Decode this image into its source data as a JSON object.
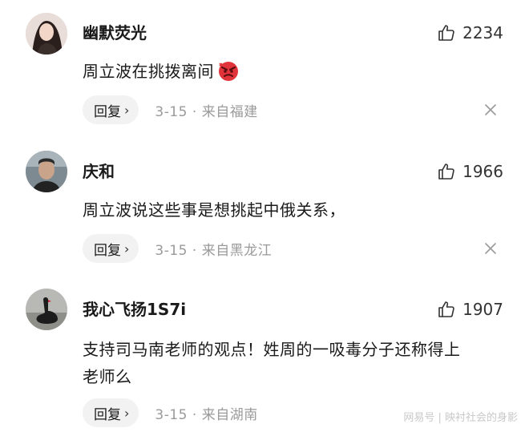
{
  "comments": [
    {
      "username": "幽默荧光",
      "likes": "2234",
      "text": "周立波在挑拨离间",
      "emoji": "angry-face",
      "reply_label": "回复",
      "meta": "3-15 · 来自福建"
    },
    {
      "username": "庆和",
      "likes": "1966",
      "text": "周立波说这些事是想挑起中俄关系，",
      "reply_label": "回复",
      "meta": "3-15 · 来自黑龙江"
    },
    {
      "username": "我心飞扬1S7i",
      "likes": "1907",
      "text_line1": "支持司马南老师的观点！姓周的一吸毒分子还称得上",
      "text_line2": "老师么",
      "reply_label": "回复",
      "meta": "3-15 · 来自湖南"
    }
  ],
  "watermark": "网易号 | 映衬社会的身影",
  "icons": [
    "thumbs-up-icon",
    "close-icon",
    "chevron-right-icon",
    "angry-face-icon"
  ]
}
